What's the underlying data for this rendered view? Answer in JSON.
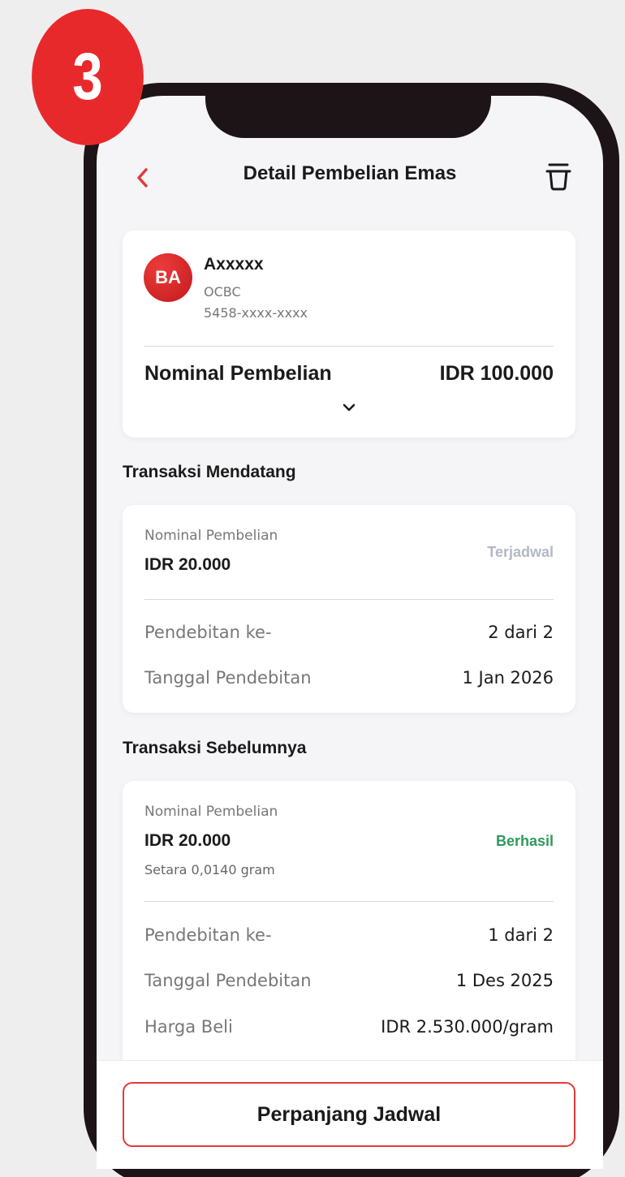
{
  "step": {
    "number": "3"
  },
  "header": {
    "title": "Detail Pembelian Emas"
  },
  "account": {
    "initials": "BA",
    "name": "Axxxxx",
    "bank": "OCBC",
    "number": "5458-xxxx-xxxx"
  },
  "summary": {
    "label": "Nominal Pembelian",
    "value": "IDR 100.000"
  },
  "upcoming": {
    "section_title": "Transaksi Mendatang",
    "amount_label": "Nominal Pembelian",
    "amount": "IDR 20.000",
    "status": "Terjadwal",
    "rows": [
      {
        "label": "Pendebitan ke-",
        "value": "2 dari 2"
      },
      {
        "label": "Tanggal Pendebitan",
        "value": "1 Jan 2026"
      }
    ]
  },
  "previous": {
    "section_title": "Transaksi Sebelumnya",
    "amount_label": "Nominal Pembelian",
    "amount": "IDR 20.000",
    "equivalent": "Setara 0,0140 gram",
    "status": "Berhasil",
    "rows": [
      {
        "label": "Pendebitan ke-",
        "value": "1 dari 2"
      },
      {
        "label": "Tanggal Pendebitan",
        "value": "1 Des 2025"
      },
      {
        "label": "Harga Beli",
        "value": "IDR 2.530.000/gram"
      }
    ]
  },
  "footer": {
    "button_label": "Perpanjang Jadwal"
  },
  "colors": {
    "accent": "#e23a3a",
    "status_scheduled": "#b4b8c4",
    "status_success": "#2e9a5a"
  },
  "icons": {
    "back": "chevron-left-icon",
    "delete": "trash-icon",
    "expand": "chevron-down-icon"
  }
}
